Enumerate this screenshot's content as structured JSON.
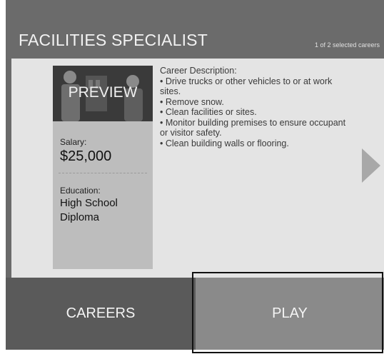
{
  "header": {
    "title": "FACILITIES SPECIALIST",
    "counter": "1 of 2 selected careers"
  },
  "card": {
    "preview_label": "PREVIEW",
    "salary_label": "Salary:",
    "salary_value": "$25,000",
    "education_label": "Education:",
    "education_value": "High School Diploma"
  },
  "description": {
    "heading": "Career Description:",
    "items": [
      "• Drive trucks or other vehicles to or at work sites.",
      "• Remove snow.",
      "• Clean facilities or sites.",
      "• Monitor building premises to ensure occupant or visitor safety.",
      "• Clean building walls or flooring."
    ]
  },
  "navigation": {
    "next_icon": "chevron-right-icon"
  },
  "buttons": {
    "careers": "CAREERS",
    "play": "PLAY"
  },
  "colors": {
    "header_bg": "#6b6b6b",
    "panel_bg": "#e4e4e4",
    "card_bg": "#bdbdbd",
    "careers_bg": "#5a5a5a",
    "play_bg": "#8a8a8a"
  }
}
